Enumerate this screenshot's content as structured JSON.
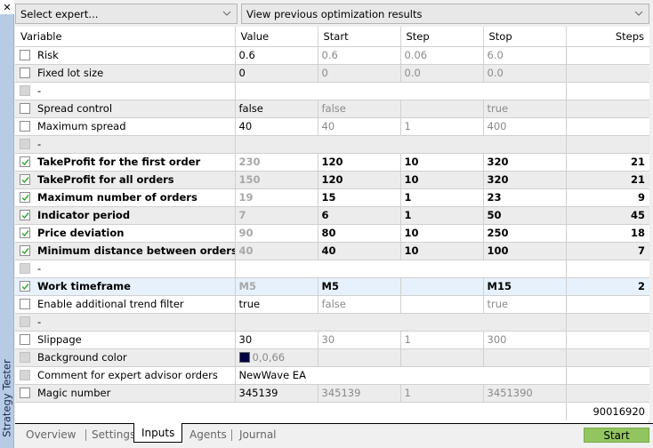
{
  "window": {
    "panel_title": "Strategy Tester",
    "close_icon": "close-icon"
  },
  "toolbar": {
    "expert_select": "Select expert...",
    "results_select": "View previous optimization results"
  },
  "table": {
    "headers": {
      "variable": "Variable",
      "value": "Value",
      "start": "Start",
      "step": "Step",
      "stop": "Stop",
      "steps": "Steps"
    },
    "rows": [
      {
        "variable": "Risk",
        "value": "0.6",
        "start": "0.6",
        "step": "0.06",
        "stop": "6.0",
        "steps": "",
        "checked": false
      },
      {
        "variable": "Fixed lot size",
        "value": "0",
        "start": "0",
        "step": "0.0",
        "stop": "0.0",
        "steps": "",
        "checked": false
      },
      {
        "variable": "-",
        "value": "",
        "start": "",
        "step": "",
        "stop": "",
        "steps": "",
        "checked": false,
        "separator": true
      },
      {
        "variable": "Spread control",
        "value": "false",
        "start": "false",
        "step": "",
        "stop": "true",
        "steps": "",
        "checked": false
      },
      {
        "variable": "Maximum spread",
        "value": "40",
        "start": "40",
        "step": "1",
        "stop": "400",
        "steps": "",
        "checked": false
      },
      {
        "variable": "-",
        "value": "",
        "start": "",
        "step": "",
        "stop": "",
        "steps": "",
        "checked": false,
        "separator": true
      },
      {
        "variable": "TakeProfit for the first order",
        "value": "230",
        "start": "120",
        "step": "10",
        "stop": "320",
        "steps": "21",
        "checked": true
      },
      {
        "variable": "TakeProfit for all orders",
        "value": "150",
        "start": "120",
        "step": "10",
        "stop": "320",
        "steps": "21",
        "checked": true
      },
      {
        "variable": "Maximum number of orders",
        "value": "19",
        "start": "15",
        "step": "1",
        "stop": "23",
        "steps": "9",
        "checked": true
      },
      {
        "variable": "Indicator period",
        "value": "7",
        "start": "6",
        "step": "1",
        "stop": "50",
        "steps": "45",
        "checked": true
      },
      {
        "variable": "Price deviation",
        "value": "90",
        "start": "80",
        "step": "10",
        "stop": "250",
        "steps": "18",
        "checked": true
      },
      {
        "variable": "Minimum distance between orders",
        "value": "40",
        "start": "40",
        "step": "10",
        "stop": "100",
        "steps": "7",
        "checked": true
      },
      {
        "variable": "-",
        "value": "",
        "start": "",
        "step": "",
        "stop": "",
        "steps": "",
        "checked": false,
        "separator": true
      },
      {
        "variable": "Work timeframe",
        "value": "M5",
        "start": "M5",
        "step": "",
        "stop": "M15",
        "steps": "2",
        "checked": true,
        "selected": true
      },
      {
        "variable": "Enable additional trend filter",
        "value": "true",
        "start": "false",
        "step": "",
        "stop": "true",
        "steps": "",
        "checked": false
      },
      {
        "variable": "-",
        "value": "",
        "start": "",
        "step": "",
        "stop": "",
        "steps": "",
        "checked": false,
        "separator": true
      },
      {
        "variable": "Slippage",
        "value": "30",
        "start": "30",
        "step": "1",
        "stop": "300",
        "steps": "",
        "checked": false
      },
      {
        "variable": "Background color",
        "value": "0,0,66",
        "start": "",
        "step": "",
        "stop": "",
        "steps": "",
        "checked": false,
        "disabled": true,
        "color": "#000042"
      },
      {
        "variable": "Comment for expert advisor orders",
        "value": "NewWave EA",
        "start": "",
        "step": "",
        "stop": "",
        "steps": "",
        "checked": false,
        "disabled": true
      },
      {
        "variable": "Magic number",
        "value": "345139",
        "start": "345139",
        "step": "1",
        "stop": "3451390",
        "steps": "",
        "checked": false
      }
    ],
    "total_steps": "90016920"
  },
  "tabs": [
    {
      "label": "Overview",
      "active": false
    },
    {
      "label": "Settings",
      "active": false
    },
    {
      "label": "Inputs",
      "active": true
    },
    {
      "label": "Agents",
      "active": false
    },
    {
      "label": "Journal",
      "active": false
    }
  ],
  "start_button": "Start",
  "colors": {
    "start_green": "#92c560",
    "selected_row": "#e6f1fc",
    "check_green": "#2aa52a",
    "panel_blue": "#b7cbe4"
  }
}
